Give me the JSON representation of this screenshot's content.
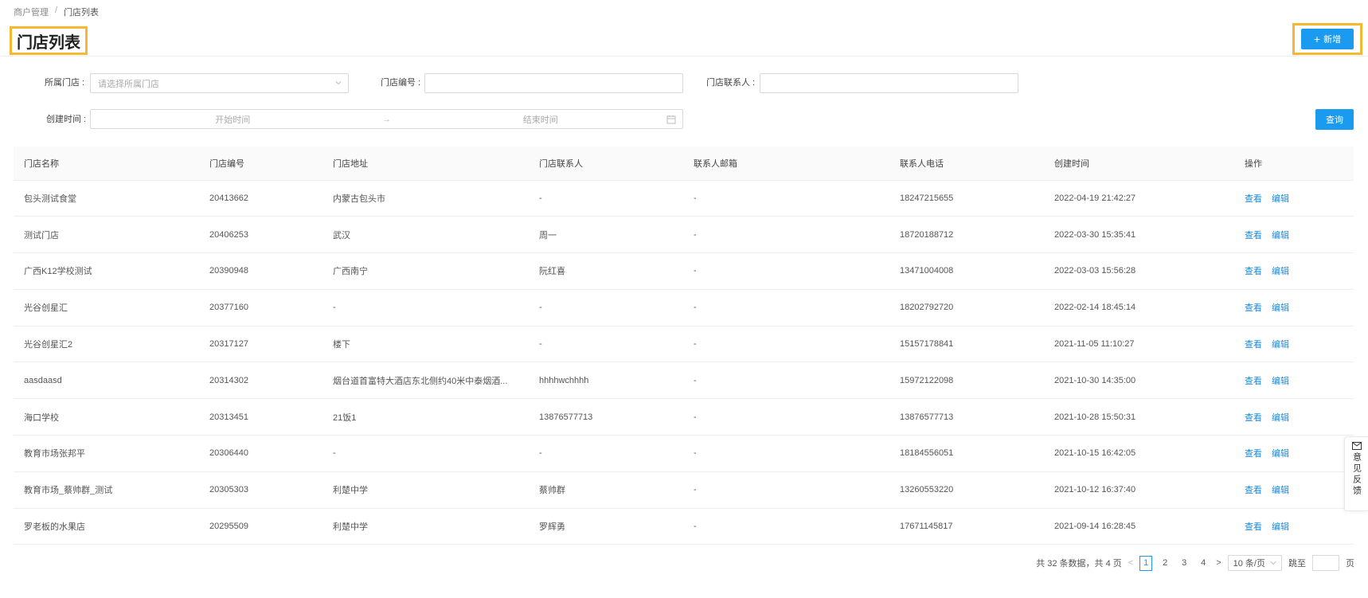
{
  "breadcrumb": {
    "root": "商户管理",
    "separator": "/",
    "current": "门店列表"
  },
  "page_title": "门店列表",
  "add_button": {
    "label": "新增"
  },
  "filters": {
    "store": {
      "label": "所属门店 :",
      "placeholder": "请选择所属门店"
    },
    "store_no": {
      "label": "门店编号 :",
      "value": ""
    },
    "contact": {
      "label": "门店联系人 :",
      "value": ""
    },
    "created": {
      "label": "创建时间 :",
      "start": "开始时间",
      "arrow": "→",
      "end": "结束时间"
    },
    "query_label": "查询"
  },
  "table": {
    "columns": [
      "门店名称",
      "门店编号",
      "门店地址",
      "门店联系人",
      "联系人邮箱",
      "联系人电话",
      "创建时间",
      "操作"
    ],
    "rows": [
      [
        "包头测试食堂",
        "20413662",
        "内蒙古包头市",
        "-",
        "-",
        "18247215655",
        "2022-04-19 21:42:27"
      ],
      [
        "测试门店",
        "20406253",
        "武汉",
        "周一",
        "-",
        "18720188712",
        "2022-03-30 15:35:41"
      ],
      [
        "广西K12学校测试",
        "20390948",
        "广西南宁",
        "阮红喜",
        "-",
        "13471004008",
        "2022-03-03 15:56:28"
      ],
      [
        "光谷创星汇",
        "20377160",
        "-",
        "-",
        "-",
        "18202792720",
        "2022-02-14 18:45:14"
      ],
      [
        "光谷创星汇2",
        "20317127",
        "楼下",
        "-",
        "-",
        "15157178841",
        "2021-11-05 11:10:27"
      ],
      [
        "aasdaasd",
        "20314302",
        "烟台道首富特大酒店东北侧约40米中泰烟酒...",
        "hhhhwchhhh",
        "-",
        "15972122098",
        "2021-10-30 14:35:00"
      ],
      [
        "海口学校",
        "20313451",
        "21饭1",
        "13876577713",
        "-",
        "13876577713",
        "2021-10-28 15:50:31"
      ],
      [
        "教育市场张邦平",
        "20306440",
        "-",
        "-",
        "-",
        "18184556051",
        "2021-10-15 16:42:05"
      ],
      [
        "教育市场_蔡帅群_测试",
        "20305303",
        "利楚中学",
        "蔡帅群",
        "-",
        "13260553220",
        "2021-10-12 16:37:40"
      ],
      [
        "罗老板的水果店",
        "20295509",
        "利楚中学",
        "罗辉勇",
        "-",
        "17671145817",
        "2021-09-14 16:28:45"
      ]
    ],
    "actions": {
      "view": "查看",
      "edit": "编辑"
    }
  },
  "pagination": {
    "summary": "共 32 条数据，共 4 页",
    "prev": "<",
    "pages": [
      "1",
      "2",
      "3",
      "4"
    ],
    "next": ">",
    "page_size": "10 条/页",
    "jump_label": "跳至",
    "page_suffix": "页"
  },
  "feedback": {
    "label": "意见反馈"
  },
  "icons": {
    "select": "chevron-down-icon",
    "calendar": "calendar-icon",
    "feedback": "mail-icon",
    "add": "plus-icon"
  },
  "colors": {
    "primary": "#1a9bf0",
    "link": "#1a8bdc",
    "highlight": "#f5b82e"
  }
}
